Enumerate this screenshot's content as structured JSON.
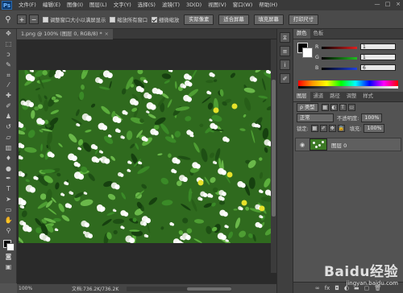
{
  "menubar": {
    "logo": "Ps",
    "items": [
      "文件(F)",
      "编辑(E)",
      "图像(I)",
      "图层(L)",
      "文字(Y)",
      "选择(S)",
      "滤镜(T)",
      "3D(D)",
      "视图(V)",
      "窗口(W)",
      "帮助(H)"
    ],
    "window_controls": [
      "—",
      "□",
      "×"
    ]
  },
  "options": {
    "resize_windows": "调整窗口大小以满屏显示",
    "zoom_all": "缩放所有窗口",
    "scrubby_zoom": "细微缩放",
    "actual_pixels": "实际像素",
    "fit_screen": "适合屏幕",
    "fill_screen": "填充屏幕",
    "print_size": "打印尺寸"
  },
  "document": {
    "tab": "1.png @ 100% (图层 0, RGB/8) *",
    "tab_close": "×"
  },
  "status": {
    "zoom": "100%",
    "doc_size": "文档:736.2K/736.2K"
  },
  "color_panel": {
    "tabs": [
      "颜色",
      "色板"
    ],
    "r": {
      "label": "R",
      "value": "1",
      "color": "#e02020"
    },
    "g": {
      "label": "G",
      "value": "1",
      "color": "#20c020"
    },
    "b": {
      "label": "B",
      "value": "6",
      "color": "#2040e0"
    }
  },
  "layers_panel": {
    "tabs": [
      "图层",
      "通道",
      "路径",
      "调整",
      "样式"
    ],
    "kind": "ρ 类型",
    "blend_mode": "正常",
    "opacity_label": "不透明度:",
    "opacity_value": "100%",
    "lock_label": "锁定:",
    "fill_label": "填充:",
    "fill_value": "100%",
    "layer_name": "图层 0"
  },
  "watermark": {
    "brand": "Baidu经验",
    "url": "jingyan.baidu.com"
  }
}
